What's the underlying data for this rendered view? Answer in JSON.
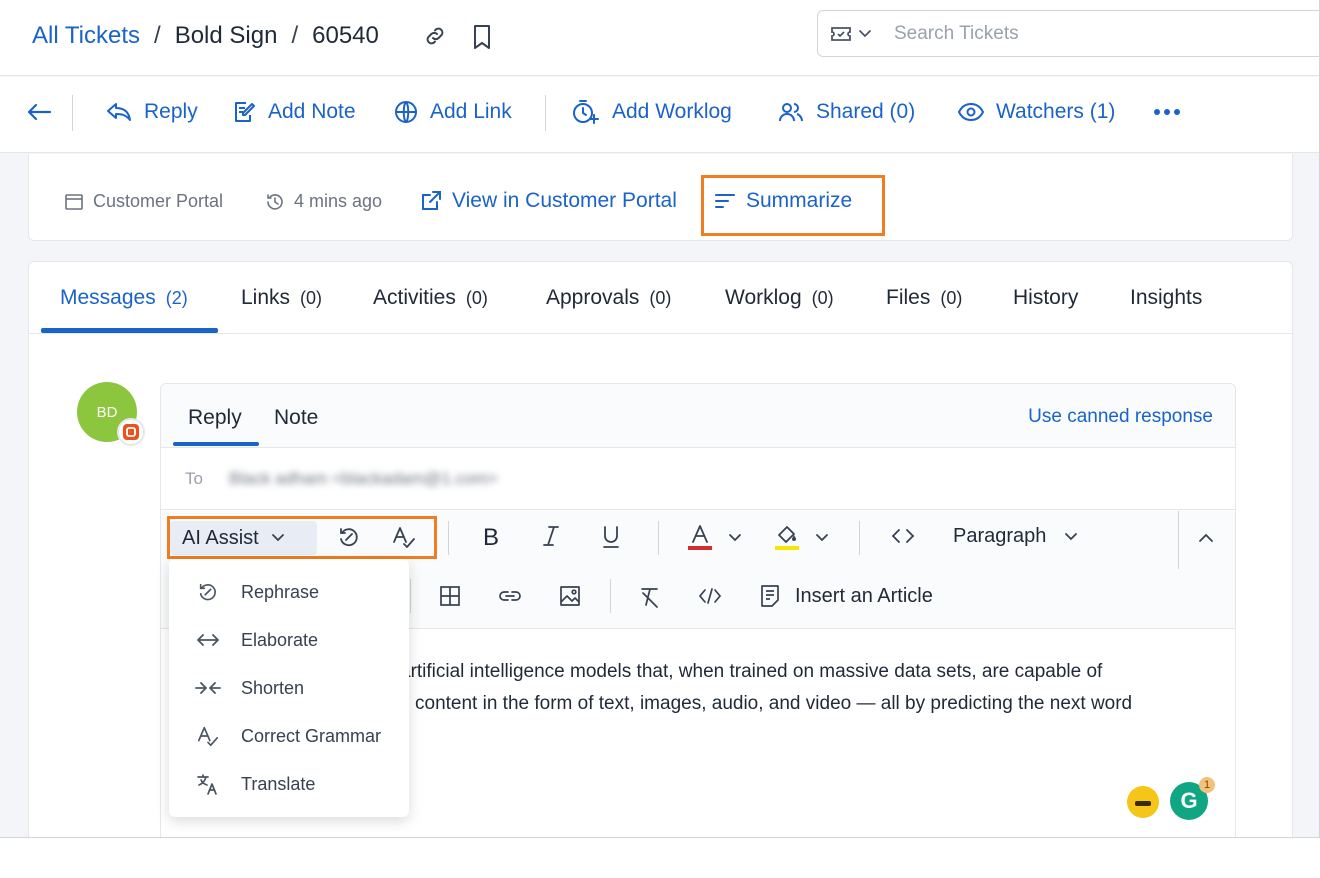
{
  "header": {
    "breadcrumb": {
      "root": "All Tickets",
      "sep": "/",
      "group": "Bold Sign",
      "ticket_id": "60540"
    },
    "search": {
      "placeholder": "Search Tickets"
    }
  },
  "toolbar": {
    "reply": "Reply",
    "add_note": "Add Note",
    "add_link": "Add Link",
    "add_worklog": "Add Worklog",
    "shared": "Shared (0)",
    "watchers": "Watchers (1)"
  },
  "info": {
    "source": "Customer Portal",
    "time": "4 mins ago",
    "view_portal": "View in Customer Portal",
    "summarize": "Summarize"
  },
  "tabs": [
    {
      "label": "Messages",
      "count": "(2)"
    },
    {
      "label": "Links",
      "count": "(0)"
    },
    {
      "label": "Activities",
      "count": "(0)"
    },
    {
      "label": "Approvals",
      "count": "(0)"
    },
    {
      "label": "Worklog",
      "count": "(0)"
    },
    {
      "label": "Files",
      "count": "(0)"
    },
    {
      "label": "History"
    },
    {
      "label": "Insights"
    }
  ],
  "avatar": {
    "initials": "BD"
  },
  "composer": {
    "tabs": [
      "Reply",
      "Note"
    ],
    "canned": "Use canned response",
    "to_label": "To",
    "to_value": "Black adham <blackadam@1.com>",
    "ai_assist": "AI Assist",
    "paragraph": "Paragraph",
    "insert_article": "Insert an Article",
    "body_line1": "artificial intelligence models that, when trained on massive data sets, are capable of",
    "body_line2": "content in the form of text, images, audio, and video — all by predicting the next word",
    "grammarly_count": "1"
  },
  "ai_menu": [
    "Rephrase",
    "Elaborate",
    "Shorten",
    "Correct Grammar",
    "Translate"
  ],
  "colors": {
    "accent": "#1a63c9",
    "highlight": "#ef7d22",
    "avatar": "#8cc63f"
  }
}
